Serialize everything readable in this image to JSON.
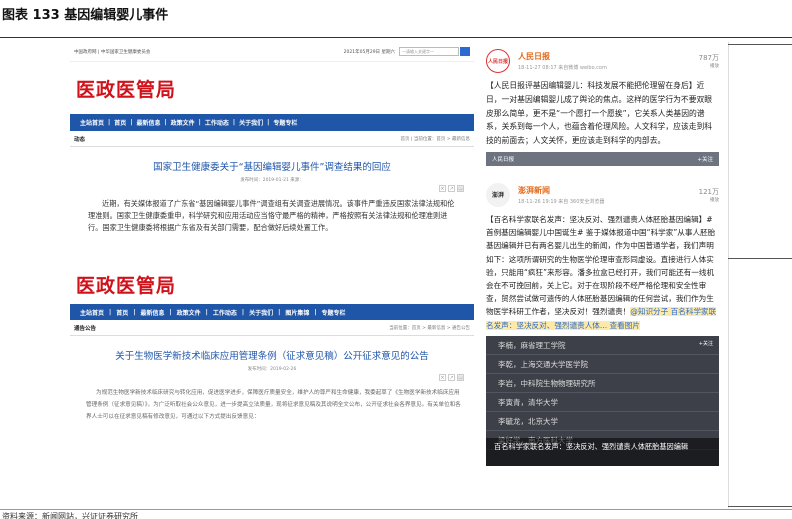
{
  "figure": {
    "title": "图表 133  基因编辑婴儿事件",
    "source": "资料来源：新闻网站，兴证证券研究所"
  },
  "gov_site_1": {
    "topbar_left": "中国政府网  |  中华国家卫生健康委员会",
    "topbar_date": "2021年05月29日 星期六",
    "search_placeholder": "一请输入关键字一",
    "brand": "医政医管局",
    "nav": [
      "主站首页",
      "|",
      "首页",
      "|",
      "最新信息",
      "|",
      "政策文件",
      "|",
      "工作动态",
      "|",
      "关于我们",
      "|",
      "专题专栏"
    ],
    "section": "动态",
    "path": "首页 | 当前位置：首页 > 最新信息",
    "article_title": "国家卫生健康委关于“基因编辑婴儿事件”调查结果的回应",
    "article_meta": "发布时间：2019-01-21    来源：",
    "article_body": "近期，有关媒体报道了广东省“基因编辑婴儿事件”调查组有关调查进展情况。该事件严重违反国家法律法规和伦理准则。国家卫生健康委重申，科学研究和应用活动应当恪守最严格的精神，严格按照有关法律法规和伦理准则进行。国家卫生健康委将根据广东省及有关部门需要，配合做好后续处置工作。"
  },
  "gov_site_2": {
    "brand": "医政医管局",
    "nav": [
      "主站首页",
      "|",
      "首页",
      "|",
      "最新信息",
      "|",
      "政策文件",
      "|",
      "工作动态",
      "|",
      "关于我们",
      "|",
      "图片集锦",
      "|",
      "专题专栏"
    ],
    "section": "通告公告",
    "path": "当前位置：首页 > 最新信息 > 通告公告",
    "article_title": "关于生物医学新技术临床应用管理条例（征求意见稿）公开征求意见的公告",
    "article_meta": "发布时间：2019-02-26",
    "article_body": "为规范生物医学新技术临床研究与转化应用，促进医学进步，保障医疗质量安全，维护人的尊严和生命健康，我委起草了《生物医学新技术临床应用管理条例（征求意见稿）》，为广泛听取社会公众意见，进一步提高立法质量，现将征求意见稿及其说明全文公布，公开征求社会各界意见。有关单位和各界人士可以在征求意见稿有修改意见，可通过以下方式提出反馈意见："
  },
  "weibo_1": {
    "avatar_text": "人民日报",
    "name": "人民日报",
    "time": "18-11-27 08:17  来自微博 weibo.com",
    "reposts": "787万",
    "reposts_label": "播放",
    "text": "【人民日报评基因编辑婴儿：科技发展不能把伦理留在身后】近日，一对基因编辑婴儿成了舆论的焦点。这样的医学行为不要双眼皮那么简单，更不是“一个愿打一个愿挨”，它关系人类基因的谱系，关系到每一个人，也蕴含着伦理风险。人文科学，应该走到科技的前面去；人文关怀，更应该走到科学的内部去。",
    "strip_left": "人民日报",
    "strip_right": "+关注"
  },
  "weibo_2": {
    "avatar_text": "澎湃",
    "name": "澎湃新闻",
    "time": "18-11-26 19:19  来自 360安全浏览器",
    "reposts": "121万",
    "reposts_label": "播放",
    "text": "【百名科学家联名发声：坚决反对、强烈谴责人体胚胎基因编辑】#首例基因编辑婴儿中国诞生# 鉴于媒体报道中国“科学家”从事人胚胎基因编辑并已有两名婴儿出生的新闻，作为中国普通学者，我们声明如下：这项所谓研究的生物医学伦理审查形同虚设。直接进行人体实验，只能用“疯狂”来形容。潘多拉盒已经打开，我们可能还有一线机会在不可挽回前，关上它。对于在现阶段不经严格伦理和安全性审查，贸然尝试做可遗传的人体胚胎基因编辑的任何尝试，我们作为生物医学科研工作者，坚决反对！强烈谴责！",
    "link_text": "@知识分子 百名科学家联名发声：坚决反对、强烈谴责人体... 查看图片",
    "list_rows": [
      "李楠，麻省理工学院",
      "李乾，上海交通大学医学院",
      "李岩，中科院生物物理研究所",
      "李寅青，清华大学",
      "李毓龙，北京大学",
      "梁好学，南方医科大学"
    ],
    "overlay_caption": "百名科学家联名发声：坚决反对、强烈谴责人体胚胎基因编辑",
    "overlay_badge": "+关注"
  }
}
